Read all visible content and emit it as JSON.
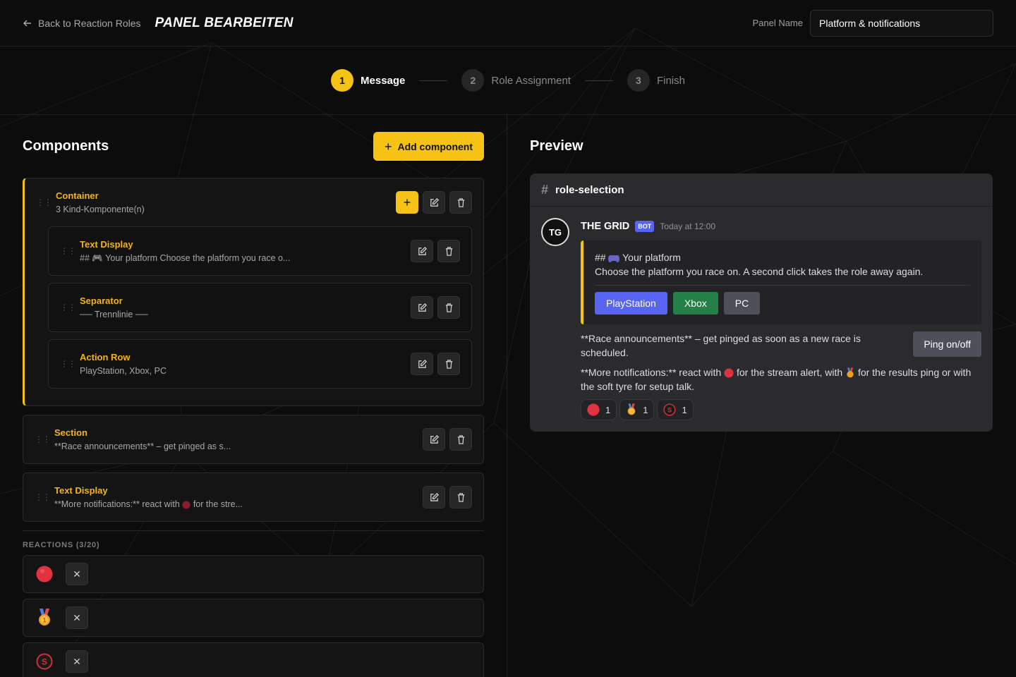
{
  "header": {
    "back_label": "Back to Reaction Roles",
    "title": "PANEL BEARBEITEN",
    "panel_name_label": "Panel Name",
    "panel_name_value": "Platform & notifications"
  },
  "stepper": {
    "steps": [
      {
        "num": "1",
        "label": "Message",
        "state": "active"
      },
      {
        "num": "2",
        "label": "Role Assignment",
        "state": "inactive"
      },
      {
        "num": "3",
        "label": "Finish",
        "state": "inactive"
      }
    ]
  },
  "components": {
    "title": "Components",
    "add_label": "Add component",
    "container": {
      "type": "Container",
      "desc": "3 Kind-Komponente(n)"
    },
    "children": [
      {
        "type": "Text Display",
        "desc": "## 🎮 Your platform Choose the platform you race o..."
      },
      {
        "type": "Separator",
        "desc": "── Trennlinie ──"
      },
      {
        "type": "Action Row",
        "desc": "PlayStation, Xbox, PC"
      }
    ],
    "section": {
      "type": "Section",
      "desc": "**Race announcements** – get pinged as s..."
    },
    "text_display": {
      "type": "Text Display",
      "desc_a": "**More notifications:** react with",
      "desc_b": "for the stre..."
    }
  },
  "reactions": {
    "label": "REACTIONS (3/20)",
    "items": [
      {
        "emoji": "red-circle-icon"
      },
      {
        "emoji": "medal-icon"
      },
      {
        "emoji": "soft-tyre-icon"
      }
    ],
    "remove_glyph": "✕"
  },
  "preview": {
    "title": "Preview",
    "channel": "role-selection",
    "hash": "#",
    "avatar_text": "TG",
    "bot_name": "THE GRID",
    "bot_tag": "BOT",
    "timestamp": "Today at 12:00",
    "embed_line1_a": "##",
    "embed_line1_b": "Your platform",
    "embed_line2": "Choose the platform you race on. A second click takes the role away again.",
    "buttons": [
      "PlayStation",
      "Xbox",
      "PC"
    ],
    "section_text": "**Race announcements** – get pinged as soon as a new race is scheduled.",
    "ping_label": "Ping on/off",
    "more_a": "**More notifications:** react with",
    "more_b": "for the stream alert, with",
    "more_c": "for the results ping or with the soft tyre for setup talk.",
    "reaction_counts": [
      "1",
      "1",
      "1"
    ]
  },
  "colors": {
    "accent": "#f5c216",
    "blurple": "#5865f2",
    "green": "#248046",
    "grey": "#4e5058"
  }
}
